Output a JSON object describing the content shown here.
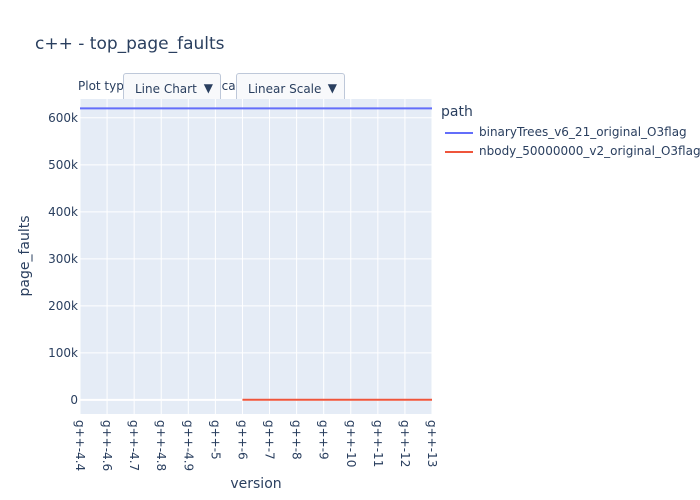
{
  "title": "c++ - top_page_faults",
  "controls": {
    "plot_type_label": "Plot type:",
    "plot_type_value": "Line Chart",
    "scale_label": "Scale:",
    "scale_value": "Linear Scale",
    "dropdown_arrow": "▼"
  },
  "legend": {
    "title": "path"
  },
  "colors": {
    "plot_bg": "#e5ecf6",
    "grid": "#ffffff",
    "tick_text": "#2a3f5f"
  },
  "chart_data": {
    "type": "line",
    "title": "c++ - top_page_faults",
    "xlabel": "version",
    "ylabel": "page_faults",
    "categories": [
      "g++-4.4",
      "g++-4.6",
      "g++-4.7",
      "g++-4.8",
      "g++-4.9",
      "g++-5",
      "g++-6",
      "g++-7",
      "g++-8",
      "g++-9",
      "g++-10",
      "g++-11",
      "g++-12",
      "g++-13"
    ],
    "ylim": [
      -30000,
      640000
    ],
    "yticks": [
      0,
      100000,
      200000,
      300000,
      400000,
      500000,
      600000
    ],
    "ytick_labels": [
      "0",
      "100k",
      "200k",
      "300k",
      "400k",
      "500k",
      "600k"
    ],
    "grid": true,
    "legend_placement": "right",
    "series": [
      {
        "name": "binaryTrees_v6_21_original_O3flag",
        "color": "#636efa",
        "x": [
          "g++-4.4",
          "g++-4.6",
          "g++-4.7",
          "g++-4.8",
          "g++-4.9",
          "g++-5",
          "g++-6",
          "g++-7",
          "g++-8",
          "g++-9",
          "g++-10",
          "g++-11",
          "g++-12",
          "g++-13"
        ],
        "values": [
          620000,
          620000,
          620000,
          620000,
          620000,
          620000,
          620000,
          620000,
          620000,
          620000,
          620000,
          620000,
          620000,
          620000
        ]
      },
      {
        "name": "nbody_50000000_v2_original_O3flag",
        "color": "#ef553b",
        "x": [
          "g++-6",
          "g++-7",
          "g++-8",
          "g++-9",
          "g++-10",
          "g++-11",
          "g++-12",
          "g++-13"
        ],
        "values": [
          300,
          300,
          300,
          300,
          300,
          300,
          300,
          300
        ]
      }
    ]
  }
}
